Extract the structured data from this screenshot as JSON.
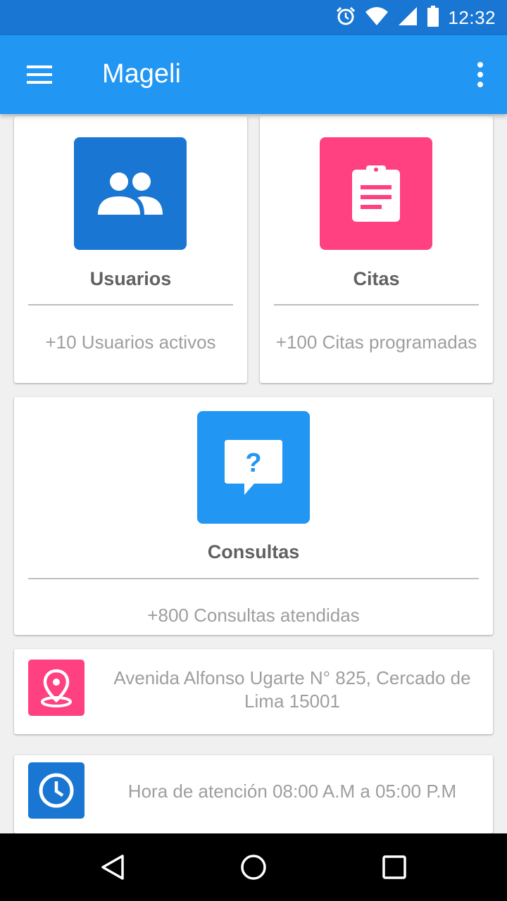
{
  "status_bar": {
    "time": "12:32",
    "icons": [
      "alarm-icon",
      "wifi-icon",
      "signal-icon",
      "battery-icon"
    ],
    "background": "#1976d2"
  },
  "app_bar": {
    "title": "Mageli",
    "background": "#2196f3",
    "menu_icon": "menu-icon",
    "overflow_icon": "more-vert-icon"
  },
  "tiles": [
    {
      "title": "Usuarios",
      "subtitle": "+10 Usuarios activos",
      "icon": "group-icon",
      "color": "#1976d2"
    },
    {
      "title": "Citas",
      "subtitle": "+100 Citas programadas",
      "icon": "clipboard-icon",
      "color": "#ff4081"
    },
    {
      "title": "Consultas",
      "subtitle": "+800 Consultas atendidas",
      "icon": "question-bubble-icon",
      "color": "#2196f3"
    }
  ],
  "info": {
    "address": "Avenida Alfonso Ugarte N° 825, Cercado de Lima 15001",
    "address_icon": "location-pin-icon",
    "address_color": "#ff4081",
    "hours": "Hora de atención 08:00 A.M a 05:00 P.M",
    "hours_icon": "clock-icon",
    "hours_color": "#1976d2"
  },
  "nav_bar": {
    "buttons": [
      "back-icon",
      "home-icon",
      "recents-icon"
    ]
  }
}
